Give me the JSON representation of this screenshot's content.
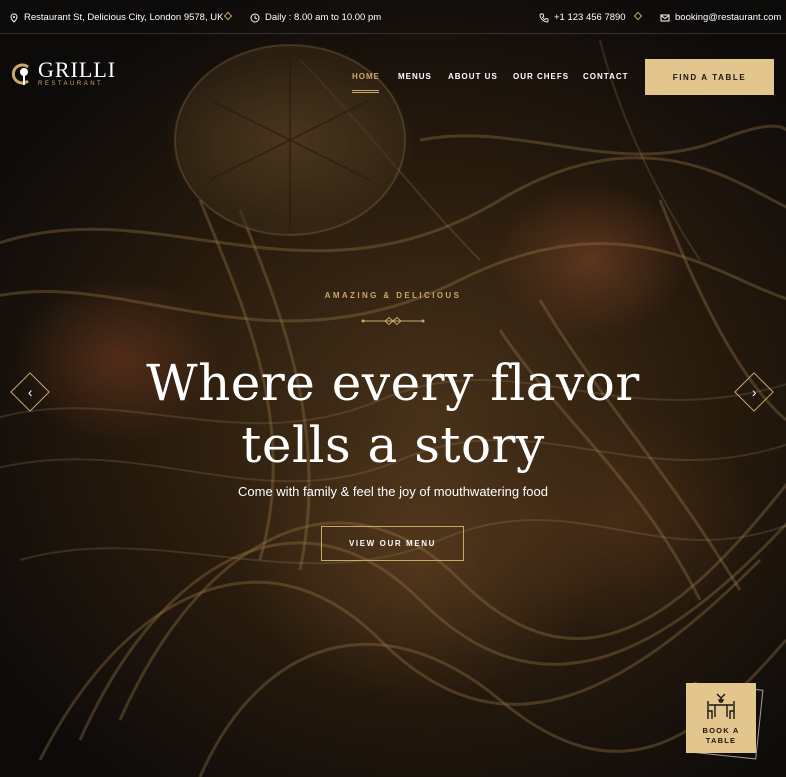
{
  "topbar": {
    "address": "Restaurant St, Delicious City, London 9578, UK",
    "hours": "Daily : 8.00 am to 10.00 pm",
    "phone": "+1 123 456 7890",
    "email": "booking@restaurant.com"
  },
  "brand": {
    "name": "GRILLI",
    "tagline": "RESTAURANT"
  },
  "nav": {
    "items": [
      {
        "label": "HOME",
        "active": true
      },
      {
        "label": "MENUS"
      },
      {
        "label": "ABOUT US"
      },
      {
        "label": "OUR CHEFS"
      },
      {
        "label": "CONTACT"
      }
    ],
    "cta": "FIND A TABLE"
  },
  "hero": {
    "kicker": "AMAZING & DELICIOUS",
    "headline_line1": "Where every flavor",
    "headline_line2": "tells a story",
    "subtitle": "Come with family & feel the joy of mouthwatering food",
    "button": "VIEW OUR MENU",
    "prev_icon": "chevron-left-icon",
    "next_icon": "chevron-right-icon"
  },
  "book": {
    "line1": "BOOK A",
    "line2": "TABLE"
  },
  "colors": {
    "accent": "#c8a86b",
    "button": "#e3c58e"
  }
}
